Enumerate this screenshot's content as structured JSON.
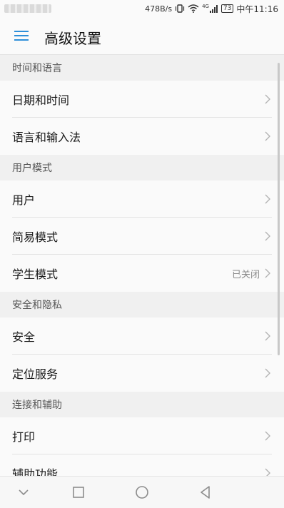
{
  "status_bar": {
    "net_speed": "478B/s",
    "signal_label": "4G",
    "battery": "73",
    "time": "中午11:16",
    "icons": [
      "vibrate-icon",
      "wifi-icon",
      "signal-icon",
      "battery-icon"
    ]
  },
  "header": {
    "title": "高级设置",
    "accent_color": "#2e8fd9"
  },
  "sections": [
    {
      "title": "时间和语言",
      "items": [
        {
          "label": "日期和时间",
          "value": ""
        },
        {
          "label": "语言和输入法",
          "value": ""
        }
      ]
    },
    {
      "title": "用户模式",
      "items": [
        {
          "label": "用户",
          "value": ""
        },
        {
          "label": "简易模式",
          "value": ""
        },
        {
          "label": "学生模式",
          "value": "已关闭"
        }
      ]
    },
    {
      "title": "安全和隐私",
      "items": [
        {
          "label": "安全",
          "value": ""
        },
        {
          "label": "定位服务",
          "value": ""
        }
      ]
    },
    {
      "title": "连接和辅助",
      "items": [
        {
          "label": "打印",
          "value": ""
        },
        {
          "label": "辅助功能",
          "value": ""
        }
      ]
    }
  ],
  "nav_bar": {
    "buttons": [
      "collapse-icon",
      "recents-icon",
      "home-icon",
      "back-icon"
    ]
  }
}
